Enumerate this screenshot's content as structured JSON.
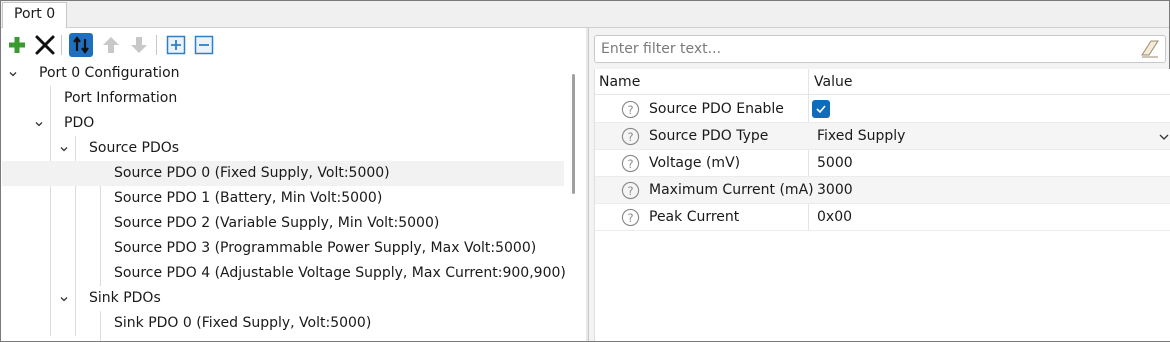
{
  "tabs": [
    {
      "label": "Port 0"
    }
  ],
  "toolbar": {
    "buttons": [
      {
        "icon": "add-icon"
      },
      {
        "icon": "delete-icon"
      },
      {
        "icon": "sort-icon"
      },
      {
        "icon": "move-up-icon"
      },
      {
        "icon": "move-down-icon"
      },
      {
        "icon": "expand-all-icon"
      },
      {
        "icon": "collapse-all-icon"
      }
    ]
  },
  "tree": {
    "items": [
      {
        "label": "Port 0 Configuration",
        "expanded": true
      },
      {
        "label": "Port Information"
      },
      {
        "label": "PDO",
        "expanded": true
      },
      {
        "label": "Source PDOs",
        "expanded": true
      },
      {
        "label": "Source PDO 0 (Fixed Supply, Volt:5000)",
        "selected": true
      },
      {
        "label": "Source PDO 1 (Battery, Min Volt:5000)"
      },
      {
        "label": "Source PDO 2 (Variable Supply, Min Volt:5000)"
      },
      {
        "label": "Source PDO 3 (Programmable Power Supply, Max Volt:5000)"
      },
      {
        "label": "Source PDO 4 (Adjustable Voltage Supply, Max Current:900,900)"
      },
      {
        "label": "Sink PDOs",
        "expanded": true
      },
      {
        "label": "Sink PDO 0 (Fixed Supply, Volt:5000)"
      }
    ]
  },
  "filter": {
    "placeholder": "Enter filter text..."
  },
  "properties": {
    "headers": {
      "name": "Name",
      "value": "Value"
    },
    "rows": [
      {
        "name": "Source PDO Enable",
        "value": "",
        "checked": true
      },
      {
        "name": "Source PDO Type",
        "value": "Fixed Supply"
      },
      {
        "name": "Voltage (mV)",
        "value": "5000"
      },
      {
        "name": "Maximum Current (mA)",
        "value": "3000"
      },
      {
        "name": "Peak Current",
        "value": "0x00"
      }
    ]
  },
  "colors": {
    "accent": "#0f6cbd",
    "add": "#3a9a2e",
    "selection": "#f2f2f2"
  }
}
